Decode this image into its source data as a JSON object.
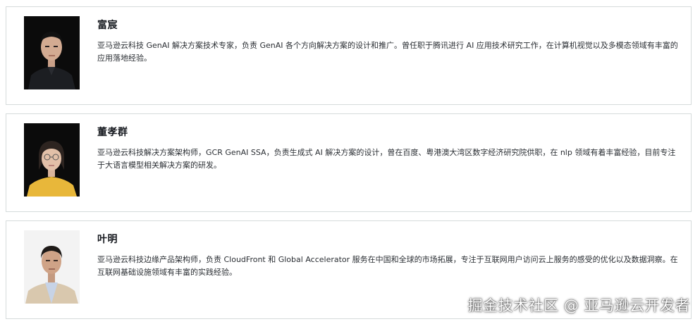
{
  "profiles": [
    {
      "name": "富宸",
      "bio": "亚马逊云科技 GenAI 解决方案技术专家，负责 GenAI 各个方向解决方案的设计和推广。曾任职于腾讯进行 AI 应用技术研究工作，在计算机视觉以及多模态领域有丰富的应用落地经验。",
      "photo_icon": "person-photo"
    },
    {
      "name": "董孝群",
      "bio": "亚马逊云科技解决方案架构师，GCR GenAI SSA，负责生成式 AI 解决方案的设计，曾在百度、粤港澳大湾区数字经济研究院供职，在 nlp 领域有着丰富经验，目前专注于大语言模型相关解决方案的研发。",
      "photo_icon": "person-photo"
    },
    {
      "name": "叶明",
      "bio": "亚马逊云科技边缘产品架构师，负责 CloudFront 和 Global Accelerator 服务在中国和全球的市场拓展，专注于互联网用户访问云上服务的感受的优化以及数据洞察。在互联网基础设施领域有丰富的实践经验。",
      "photo_icon": "person-photo"
    }
  ],
  "watermark": "掘金技术社区 @ 亚马逊云开发者",
  "colors": {
    "border": "#d5dbdb",
    "name_text": "#16191f",
    "bio_text": "#2a2e33"
  }
}
